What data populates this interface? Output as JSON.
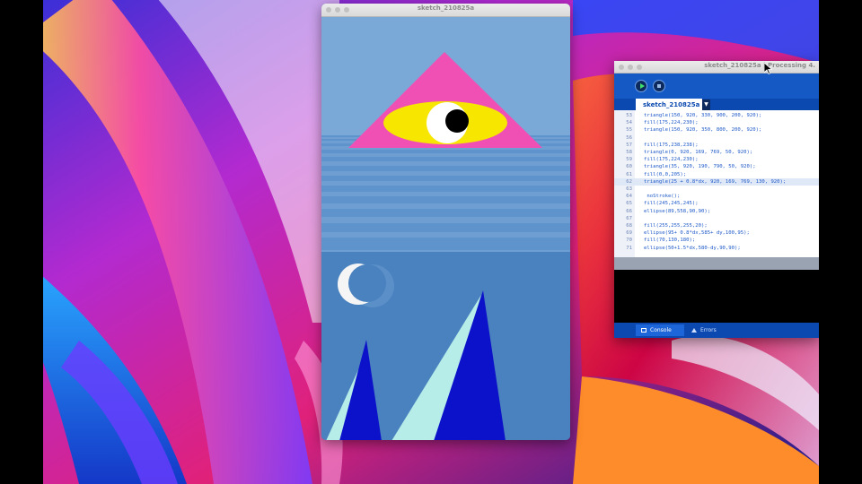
{
  "sketch_window": {
    "title": "sketch_210825a"
  },
  "ide_window": {
    "title": "sketch_210825a | Processing 4.",
    "tab_label": "sketch_210825a",
    "tab_arrow": "▼",
    "code_lines": [
      {
        "num": "53",
        "text": "triangle(150, 920, 330, 900, 200, 920);"
      },
      {
        "num": "54",
        "text": "fill(175,224,230);"
      },
      {
        "num": "55",
        "text": "triangle(150, 920, 350, 800, 200, 920);"
      },
      {
        "num": "56",
        "text": ""
      },
      {
        "num": "57",
        "text": "fill(175,238,238);"
      },
      {
        "num": "58",
        "text": "triangle(0, 920, 169, 769, 50, 920);"
      },
      {
        "num": "59",
        "text": "fill(175,224,230);"
      },
      {
        "num": "60",
        "text": "triangle(35, 920, 190, 790, 50, 920);"
      },
      {
        "num": "61",
        "text": "fill(0,0,205);"
      },
      {
        "num": "62",
        "text": "triangle(25 + 0.8*dx, 920, 169, 769, 130, 920);"
      },
      {
        "num": "63",
        "text": ""
      },
      {
        "num": "64",
        "text": " noStroke();"
      },
      {
        "num": "65",
        "text": "fill(245,245,245);"
      },
      {
        "num": "66",
        "text": "ellipse(89,558,90,90);"
      },
      {
        "num": "67",
        "text": ""
      },
      {
        "num": "68",
        "text": "fill(255,255,255,20);"
      },
      {
        "num": "69",
        "text": "ellipse(95+ 0.8*dx,585+ dy,100,95);"
      },
      {
        "num": "70",
        "text": "fill(70,130,180);"
      },
      {
        "num": "71",
        "text": "ellipse(50+1.5*dx,580-dy,90,90);"
      }
    ],
    "highlighted_line": "62",
    "console_label": "Console",
    "errors_label": "Errors"
  },
  "colors": {
    "sky": "#7aa9d8",
    "water_stripe": "#5f93cc",
    "lower_bg": "#4a82bf",
    "pyramid": "#f04fb4",
    "eye": "#f7e600",
    "mountain_dark": "#0c12c9",
    "mountain_light": "#b6ede8",
    "ide_blue": "#0b49b0"
  },
  "icons": {
    "run": "play-icon",
    "stop": "stop-icon",
    "console": "console-icon",
    "errors": "warning-icon",
    "cursor": "mouse-pointer-icon"
  }
}
